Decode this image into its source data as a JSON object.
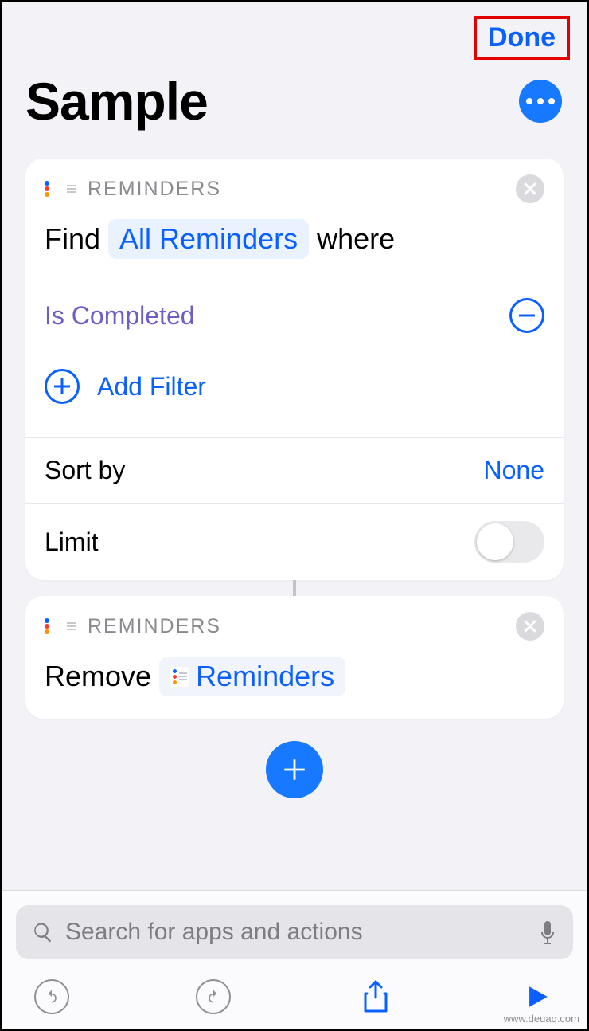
{
  "header": {
    "done_label": "Done",
    "title": "Sample"
  },
  "actions": [
    {
      "app_name": "REMINDERS",
      "verb": "Find",
      "token": "All Reminders",
      "suffix": "where",
      "filters": [
        {
          "label": "Is Completed"
        }
      ],
      "add_filter_label": "Add Filter",
      "sort_label": "Sort by",
      "sort_value": "None",
      "limit_label": "Limit",
      "limit_on": false
    },
    {
      "app_name": "REMINDERS",
      "verb": "Remove",
      "token": "Reminders"
    }
  ],
  "search": {
    "placeholder": "Search for apps and actions"
  },
  "watermark": "www.deuaq.com"
}
